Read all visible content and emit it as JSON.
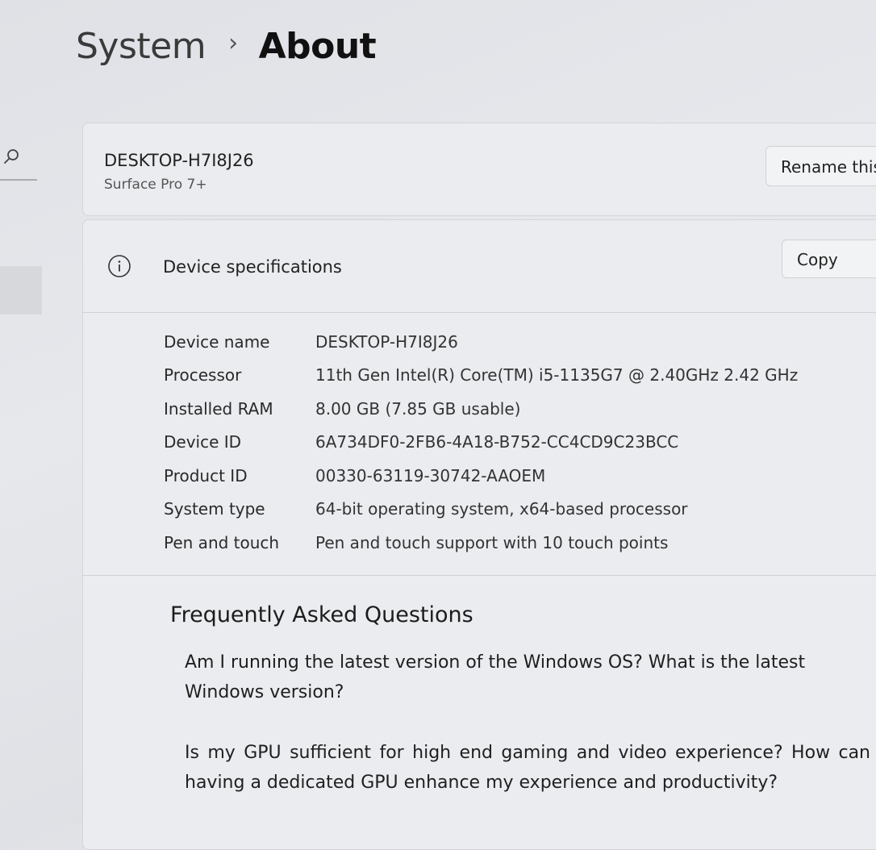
{
  "breadcrumb": {
    "parent": "System",
    "separator": "›",
    "current": "About"
  },
  "sidebar": {
    "search_icon": "search-icon"
  },
  "device": {
    "name": "DESKTOP-H7I8J26",
    "model": "Surface Pro 7+",
    "rename_label": "Rename this PC"
  },
  "specs": {
    "icon": "info-icon",
    "title": "Device specifications",
    "copy_label": "Copy",
    "rows": [
      {
        "label": "Device name",
        "value": "DESKTOP-H7I8J26"
      },
      {
        "label": "Processor",
        "value": "11th Gen Intel(R) Core(TM) i5-1135G7 @ 2.40GHz   2.42 GHz"
      },
      {
        "label": "Installed RAM",
        "value": "8.00 GB (7.85 GB usable)"
      },
      {
        "label": "Device ID",
        "value": "6A734DF0-2FB6-4A18-B752-CC4CD9C23BCC"
      },
      {
        "label": "Product ID",
        "value": "00330-63119-30742-AAOEM"
      },
      {
        "label": "System type",
        "value": "64-bit operating system, x64-based processor"
      },
      {
        "label": "Pen and touch",
        "value": "Pen and touch support with 10 touch points"
      }
    ]
  },
  "faq": {
    "title": "Frequently Asked Questions",
    "items": [
      "Am I running the latest version of the Windows OS? What is the latest Windows version?",
      "Is my GPU sufficient for high end gaming and video experience? How can having a dedicated GPU enhance my experience and productivity?"
    ]
  },
  "colors": {
    "background": "#e4e5e9",
    "card": "#ebecef",
    "text": "#1b1b1b"
  }
}
